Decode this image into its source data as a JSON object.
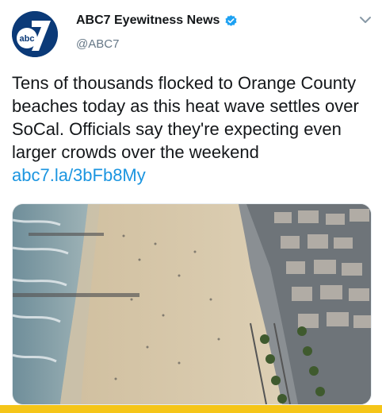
{
  "author": {
    "name": "ABC7 Eyewitness News",
    "handle": "@ABC7",
    "avatar_logo_text": "abc"
  },
  "tweet": {
    "text": "Tens of thousands flocked to Orange County beaches today as this heat wave settles over SoCal. Officials say they're expecting even larger crowds over the weekend",
    "link": "abc7.la/3bFb8My"
  },
  "colors": {
    "link": "#1b95e0",
    "verified": "#1da1f2",
    "brand": "#0b3a78",
    "bottom_bar": "#f5c518"
  },
  "icons": {
    "verified": "verified-badge-icon",
    "menu": "chevron-down-icon"
  }
}
